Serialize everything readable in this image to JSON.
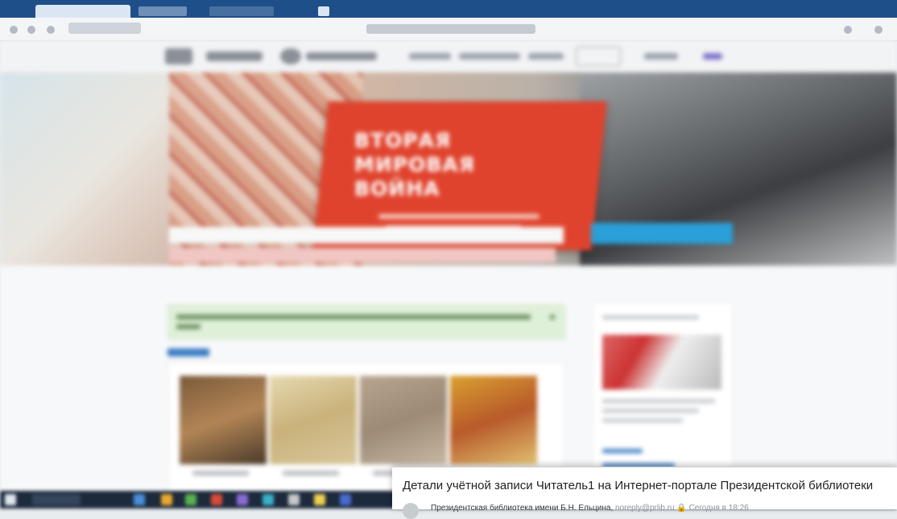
{
  "window": {
    "chrome_color": "#1f4f88",
    "toolbar_color": "#f4f5f7"
  },
  "banner": {
    "headline": "ВТОРАЯ МИРОВАЯ ВОЙНА",
    "card_color": "#e0432d",
    "search_button_color": "#2a9fd8"
  },
  "email_notification": {
    "subject": "Детали учётной записи Читатель1 на Интернет-портале Президентской библиотеки",
    "sender": "Президентская библиотека имени Б.Н. Ельцина",
    "sender_address": "noreply@prlib.ru",
    "verified_icon": "lock-icon",
    "time": "Сегодня в 18:26"
  }
}
